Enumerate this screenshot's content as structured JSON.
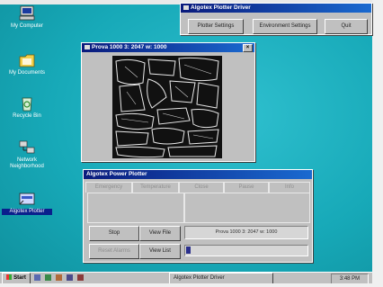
{
  "desktop": {
    "icons": [
      {
        "label": "My Computer",
        "icon": "computer-icon"
      },
      {
        "label": "My Documents",
        "icon": "folder-icon"
      },
      {
        "label": "Recycle Bin",
        "icon": "recycle-bin-icon"
      },
      {
        "label": "Network Neighborhood",
        "icon": "network-icon"
      },
      {
        "label": "Algotex Plotter",
        "icon": "plotter-shortcut-icon"
      }
    ]
  },
  "driver_window": {
    "title": "Algotex Plotter Driver",
    "buttons": [
      "Plotter Settings",
      "Environment Settings",
      "Quit"
    ]
  },
  "preview_window": {
    "title": "Prova 1000   3: 2047   w: 1000"
  },
  "power_window": {
    "title": "Algotex Power Plotter",
    "tabs": [
      "Emergency",
      "Temperature",
      "Close",
      "Pause",
      "Info"
    ],
    "stop_label": "Stop",
    "view_file_label": "View File",
    "reset_label": "Reset Alarms",
    "view_list_label": "View List",
    "file_status": "Prova 1000   3: 2047   w: 1000"
  },
  "taskbar": {
    "start_label": "Start",
    "task_label": "Algotex Plotter Driver",
    "clock": "3:48 PM"
  },
  "colors": {
    "desktop": "#17a9b8",
    "titlebar": "#0a1a7c"
  }
}
